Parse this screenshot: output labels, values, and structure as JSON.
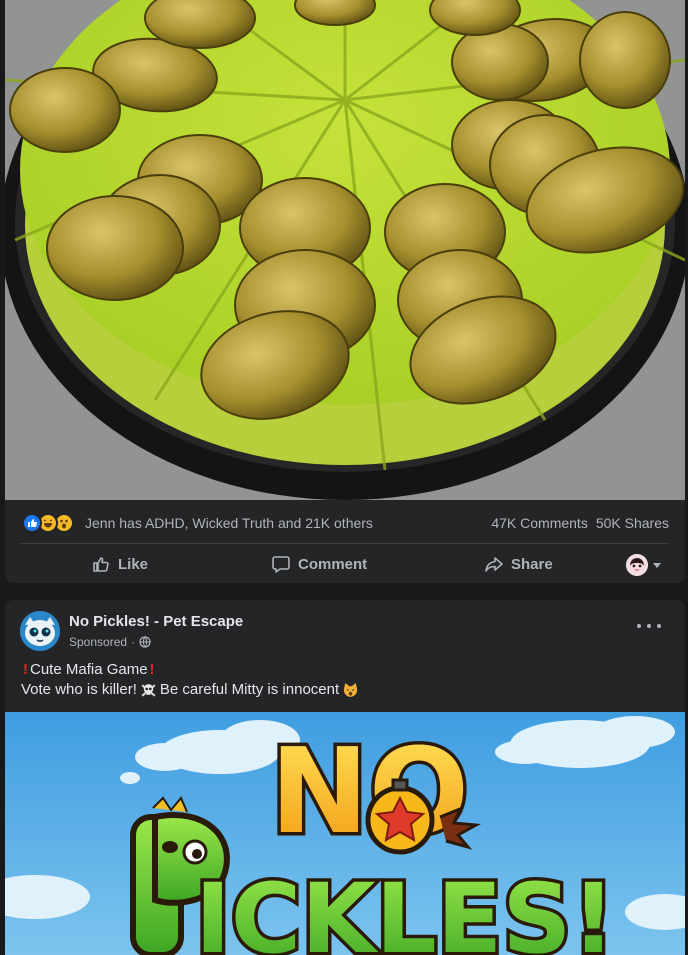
{
  "post1": {
    "image_alt": "Pickle cheesecake topped with pickle slices",
    "reactions": {
      "icons": [
        "like-icon",
        "haha-icon",
        "wow-icon"
      ],
      "summary": "Jenn has ADHD, Wicked Truth and 21K others",
      "comments": "47K Comments",
      "shares": "50K Shares"
    },
    "actions": {
      "like": "Like",
      "comment": "Comment",
      "share": "Share"
    }
  },
  "post2": {
    "page_name": "No Pickles! - Pet Escape",
    "sponsored": "Sponsored",
    "text_line1": "Cute Mafia Game",
    "text_line2_a": "Vote who is killer!",
    "text_line2_b": "Be careful Mitty is innocent",
    "logo_text_top": "NO",
    "logo_text_bottom": "ICKLES!"
  },
  "colors": {
    "background": "#18191a",
    "card": "#242526",
    "text_primary": "#e4e6eb",
    "text_secondary": "#b0b3b8",
    "like_blue": "#1877f2",
    "sky": "#4aa6e3"
  }
}
